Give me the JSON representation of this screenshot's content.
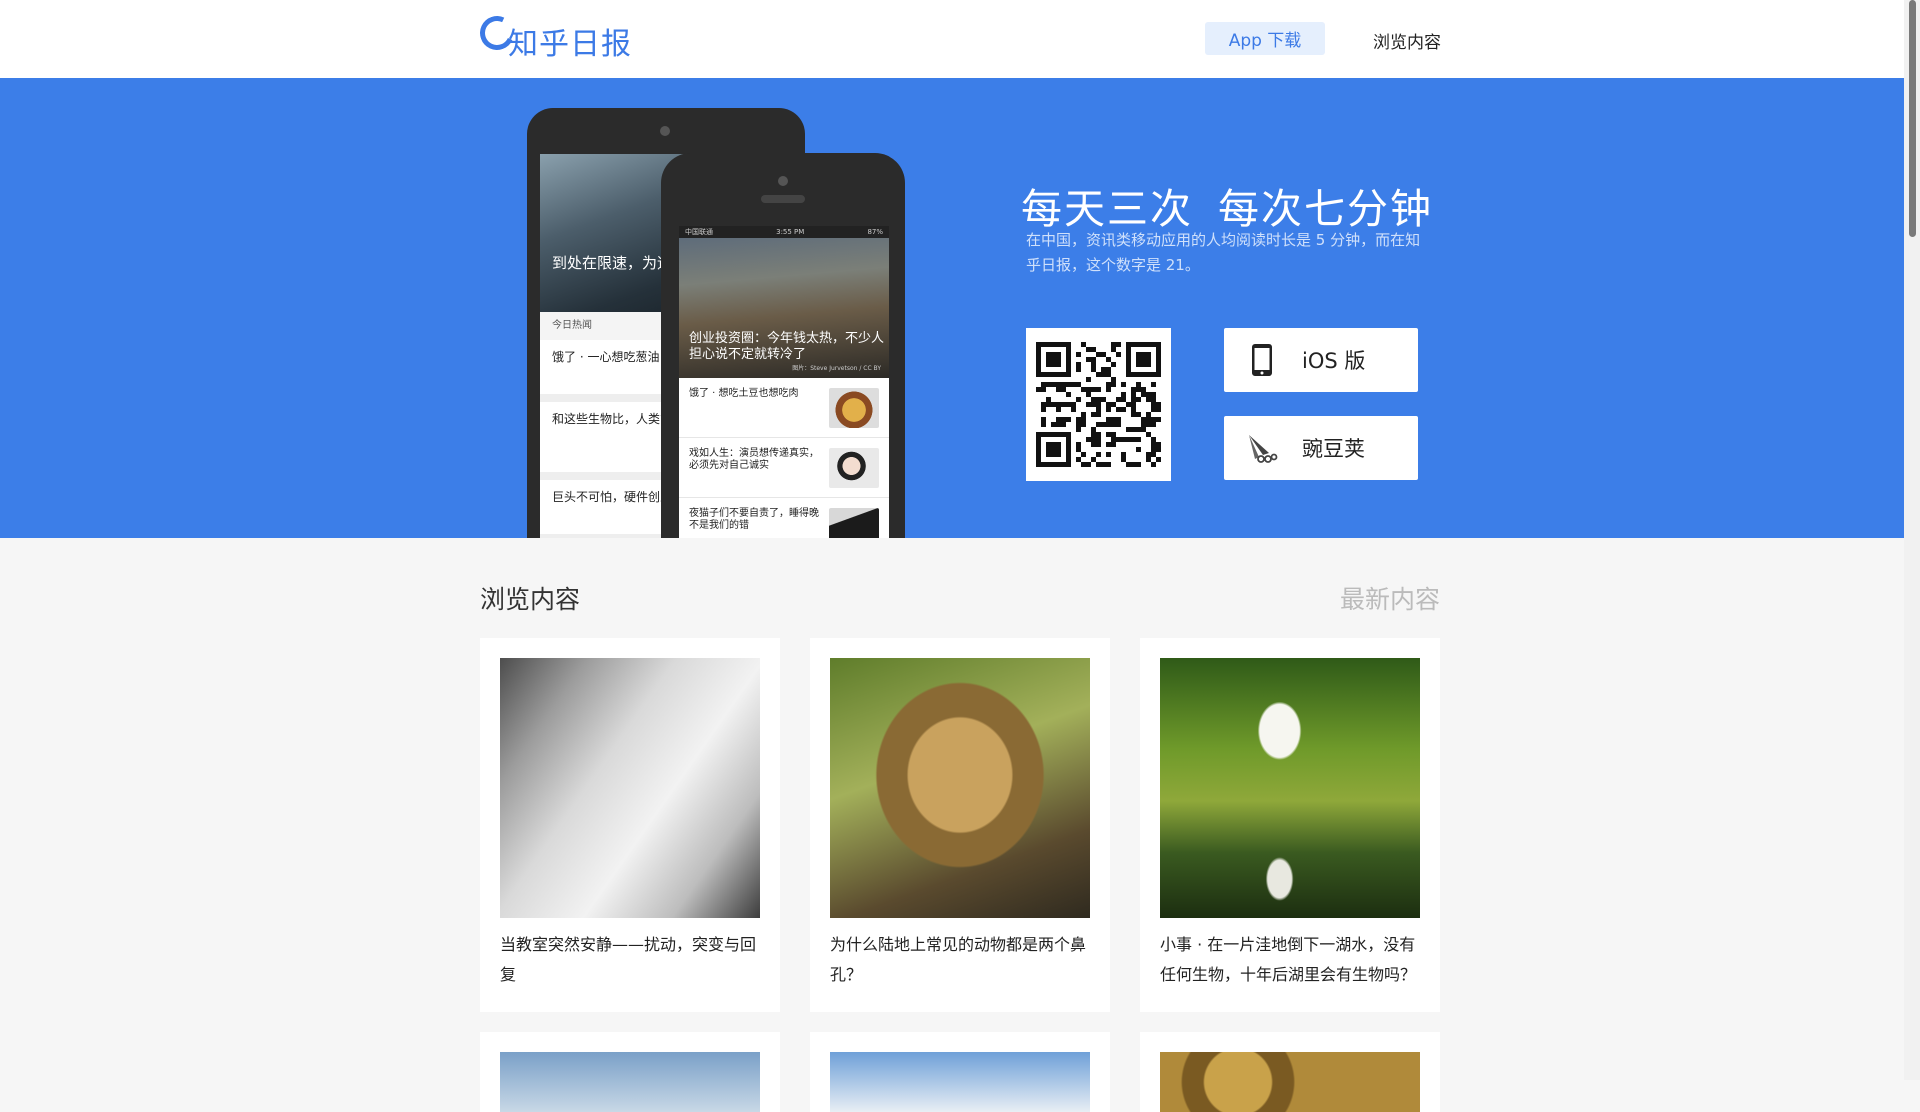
{
  "header": {
    "logo_text": "知乎日报",
    "app_download": "App 下载",
    "nav_browse": "浏览内容"
  },
  "hero": {
    "headline": "每天三次 每次七分钟",
    "subtitle": "在中国，资讯类移动应用的人均阅读时长是 5 分钟，而在知乎日报，这个数字是 21。",
    "ios_label": "iOS 版",
    "wandoujia_label": "豌豆荚",
    "back_phone": {
      "caption": "到处在限速，为速度操控为卖点",
      "section": "今日热闻",
      "items": [
        "饿了 · 一心想吃葱油",
        "和这些生物比，人类能力就像渣一样（多",
        "巨头不可怕，硬件创业队也有取胜机会"
      ]
    },
    "front_phone": {
      "status_left": "中国联通",
      "status_time": "3:55 PM",
      "status_right": "87%",
      "caption": "创业投资圈：今年钱太热，不少人担心说不定就转冷了",
      "credit": "图片：Steve Jurvetson / CC BY",
      "items": [
        "饿了 · 想吃土豆也想吃肉",
        "戏如人生：演员想传递真实，必须先对自己诚实",
        "夜猫子们不要自责了，睡得晚不是我们的错"
      ]
    }
  },
  "browse": {
    "title": "浏览内容",
    "latest": "最新内容",
    "cards": [
      {
        "title": "当教室突然安静——扰动，突变与回复"
      },
      {
        "title": "为什么陆地上常见的动物都是两个鼻孔？"
      },
      {
        "title": "小事 · 在一片洼地倒下一湖水，没有任何生物，十年后湖里会有生物吗？"
      }
    ]
  },
  "icons": {
    "ios": "iphone-icon",
    "wandoujia": "wandoujia-icon"
  },
  "colors": {
    "brand": "#3c7ae6",
    "hero_bg": "#3c7ee8",
    "page_bg": "#f6f6f6"
  }
}
